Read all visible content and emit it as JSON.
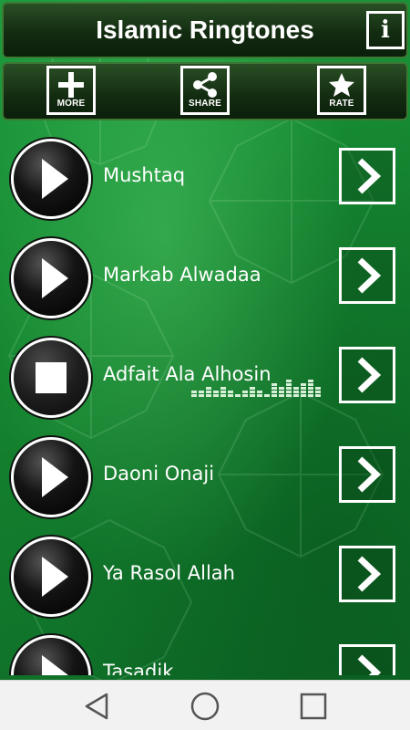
{
  "app": {
    "title": "Islamic Ringtones",
    "info_icon": "info-icon",
    "info_glyph": "i"
  },
  "toolbar": {
    "buttons": [
      {
        "label": "MORE",
        "icon": "plus-icon"
      },
      {
        "label": "SHARE",
        "icon": "share-icon"
      },
      {
        "label": "RATE",
        "icon": "star-icon"
      }
    ]
  },
  "ringtones": [
    {
      "title": "Mushtaq",
      "state": "stopped",
      "icon": "play-icon"
    },
    {
      "title": "Markab Alwadaa",
      "state": "stopped",
      "icon": "play-icon"
    },
    {
      "title": "Adfait Ala Alhosin",
      "state": "playing",
      "icon": "stop-icon",
      "equalizer": true
    },
    {
      "title": "Daoni Onaji",
      "state": "stopped",
      "icon": "play-icon"
    },
    {
      "title": "Ya Rasol Allah",
      "state": "stopped",
      "icon": "play-icon"
    },
    {
      "title": "Tasadik",
      "state": "stopped",
      "icon": "play-icon"
    }
  ],
  "navigation": {
    "buttons": [
      "back-icon",
      "home-icon",
      "recents-icon"
    ]
  },
  "colors": {
    "background_green": "#14842f",
    "header_dark": "#132c11",
    "accent_white": "#ffffff",
    "nav_bar": "#f2f2f2"
  }
}
